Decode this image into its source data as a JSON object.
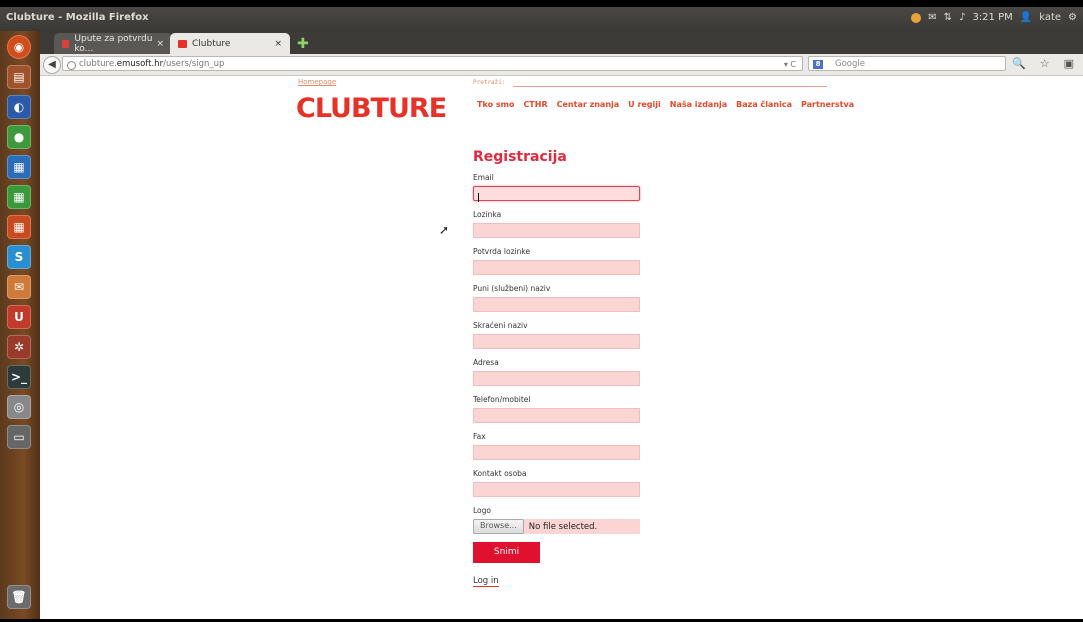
{
  "window": {
    "title": "Clubture - Mozilla Firefox"
  },
  "tray": {
    "time": "3:21 PM",
    "user": "kate"
  },
  "tabs": [
    {
      "label": "Upute za potvrdu ko...",
      "active": false,
      "favicon_color": "#d9413a"
    },
    {
      "label": "Clubture",
      "active": true,
      "favicon_color": "#e5332a"
    }
  ],
  "address": {
    "domain_prefix": "clubture.",
    "domain_main": "emusoft.hr",
    "path": "/users/sign_up"
  },
  "search": {
    "placeholder": "Google"
  },
  "page": {
    "homepage_link": "Homepage",
    "logo": "CLUBTURE",
    "search_label": "Pretraži:",
    "nav": [
      "Tko smo",
      "CTHR",
      "Centar znanja",
      "U regiji",
      "Naša izdanja",
      "Baza članica",
      "Partnerstva"
    ],
    "heading": "Registracija",
    "fields": [
      {
        "label": "Email"
      },
      {
        "label": "Lozinka"
      },
      {
        "label": "Potvrda lozinke"
      },
      {
        "label": "Puni (službeni) naziv"
      },
      {
        "label": "Skraćeni naziv"
      },
      {
        "label": "Adresa"
      },
      {
        "label": "Telefon/mobitel"
      },
      {
        "label": "Fax"
      },
      {
        "label": "Kontakt osoba"
      }
    ],
    "logo_field": {
      "label": "Logo",
      "browse": "Browse...",
      "status": "No file selected."
    },
    "submit": "Snimi",
    "login_link": "Log in"
  },
  "colors": {
    "accent": "#e0102f",
    "brand": "#e5332a",
    "field_bg": "#fbd4d4"
  }
}
